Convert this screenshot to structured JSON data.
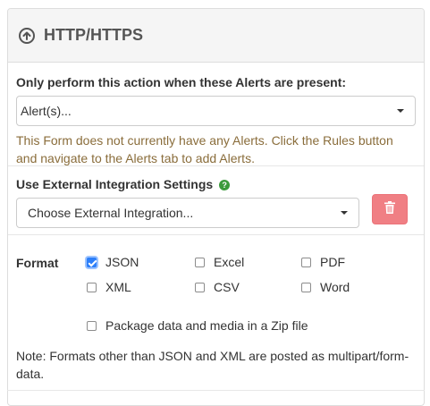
{
  "panel": {
    "title": "HTTP/HTTPS",
    "icon": "circle-arrow-up-icon"
  },
  "alerts_section": {
    "label": "Only perform this action when these Alerts are present:",
    "select_value": "Alert(s)...",
    "warning": "This Form does not currently have any Alerts. Click the Rules button and navigate to the Alerts tab to add Alerts."
  },
  "integration_section": {
    "label": "Use External Integration Settings",
    "help_icon": "question-circle-icon",
    "select_value": "Choose External Integration...",
    "delete_icon": "trash-icon",
    "delete_color": "#f07f84"
  },
  "format_section": {
    "label": "Format",
    "options": [
      {
        "label": "JSON",
        "checked": true
      },
      {
        "label": "Excel",
        "checked": false
      },
      {
        "label": "PDF",
        "checked": false
      },
      {
        "label": "XML",
        "checked": false
      },
      {
        "label": "CSV",
        "checked": false
      },
      {
        "label": "Word",
        "checked": false
      }
    ],
    "zip_option": {
      "label": "Package data and media in a Zip file",
      "checked": false
    },
    "note": "Note: Formats other than JSON and XML are posted as multipart/form-data."
  },
  "colors": {
    "warning_text": "#8a6d3b",
    "checkbox_checked": "#2d7ff9",
    "help_icon": "#3c9a3c"
  }
}
